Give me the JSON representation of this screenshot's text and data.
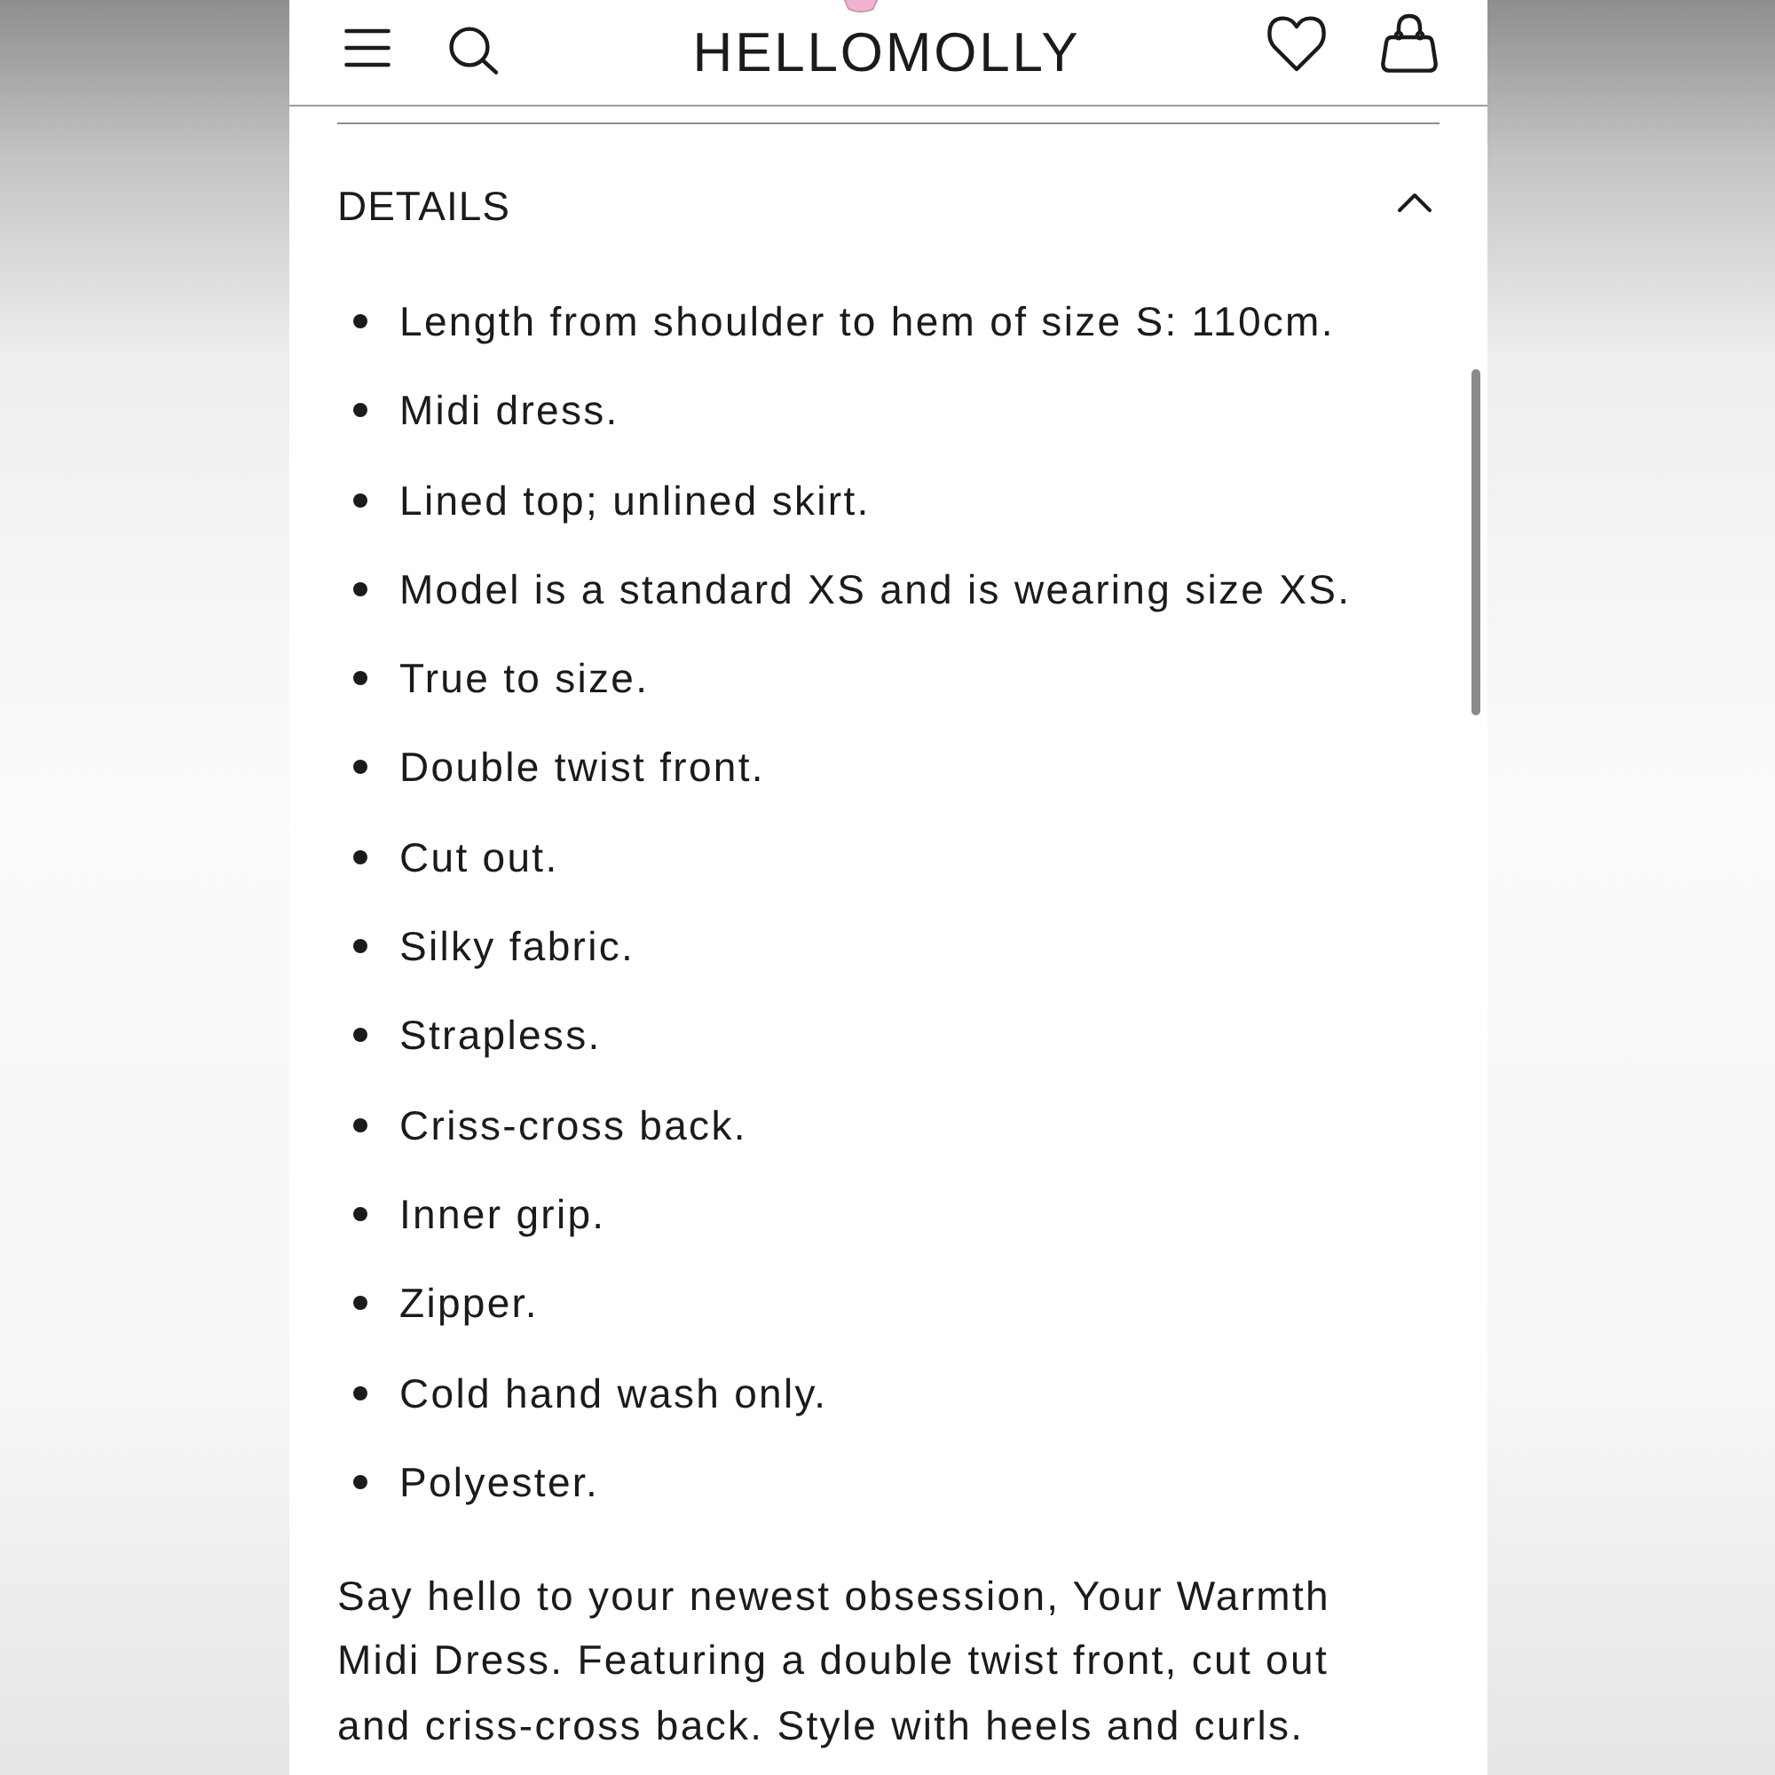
{
  "header": {
    "logo": "HELLOMOLLY"
  },
  "section": {
    "title": "DETAILS",
    "expanded": true
  },
  "details": [
    "Length from shoulder to hem of size S: 110cm.",
    "Midi dress.",
    "Lined top; unlined skirt.",
    "Model is a standard XS and is wearing size XS.",
    "True to size.",
    "Double twist front.",
    "Cut out.",
    "Silky fabric.",
    "Strapless.",
    "Criss-cross back.",
    "Inner grip.",
    "Zipper.",
    "Cold hand wash only.",
    "Polyester."
  ],
  "description": "Say hello to your newest obsession, Your Warmth Midi Dress. Featuring a double twist front, cut out and criss-cross back. Style with heels and curls."
}
